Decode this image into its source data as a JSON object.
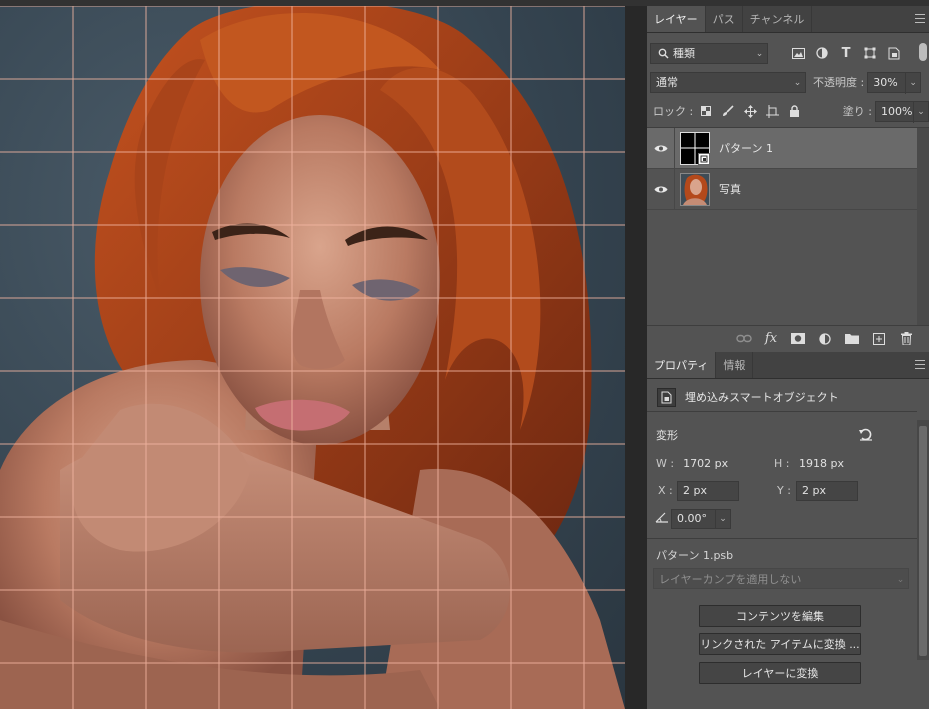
{
  "layers_panel": {
    "tabs": [
      {
        "label": "レイヤー",
        "active": true
      },
      {
        "label": "パス",
        "active": false
      },
      {
        "label": "チャンネル",
        "active": false
      }
    ],
    "filter": {
      "label": "種類"
    },
    "blend_mode": "通常",
    "opacity": {
      "label": "不透明度 :",
      "value": "30%"
    },
    "lock_label": "ロック :",
    "fill": {
      "label": "塗り :",
      "value": "100%"
    },
    "layers": [
      {
        "name": "パターン 1",
        "selected": true,
        "visible": true
      },
      {
        "name": "写真",
        "selected": false,
        "visible": true
      }
    ]
  },
  "properties_panel": {
    "tabs": [
      {
        "label": "プロパティ",
        "active": true
      },
      {
        "label": "情報",
        "active": false
      }
    ],
    "object_type": "埋め込みスマートオブジェクト",
    "transform_title": "変形",
    "w": {
      "label": "W :",
      "value": "1702 px"
    },
    "h": {
      "label": "H :",
      "value": "1918 px"
    },
    "x": {
      "label": "X :",
      "value": "2 px"
    },
    "y": {
      "label": "Y :",
      "value": "2 px"
    },
    "angle": "0.00°",
    "file_name": "パターン 1.psb",
    "layer_comp": "レイヤーカンプを適用しない",
    "buttons": {
      "edit_contents": "コンテンツを編集",
      "convert_linked": "リンクされた アイテムに変換 ...",
      "convert_layer": "レイヤーに変換"
    }
  },
  "colors": {
    "panel_bg": "#535353",
    "tabbar_bg": "#424242",
    "grid_line": "#f3b6a2",
    "backdrop": "#3a4a56",
    "hair": "#a8431b"
  },
  "icons": [
    "eye-icon",
    "search-icon",
    "image-filter-icon",
    "adjustment-filter-icon",
    "type-filter-icon",
    "shape-filter-icon",
    "smart-object-filter-icon",
    "lock-transparent-icon",
    "lock-paint-icon",
    "lock-move-icon",
    "lock-artboard-icon",
    "lock-all-icon",
    "link-icon",
    "fx-icon",
    "mask-icon",
    "adjustment-icon",
    "folder-icon",
    "new-layer-icon",
    "trash-icon",
    "reset-icon",
    "angle-icon",
    "smart-object-icon"
  ]
}
